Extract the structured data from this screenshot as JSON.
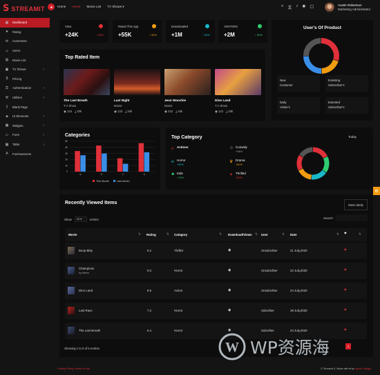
{
  "brand": {
    "name": "STREAMIT"
  },
  "topnav": {
    "home": "Home",
    "items": [
      "Home",
      "Movie List",
      "TV Shows"
    ],
    "active": 1
  },
  "user": {
    "name": "Austin Robertson",
    "role": "Marketing Administrator"
  },
  "sidebar": {
    "items": [
      {
        "label": "Dashboard",
        "icon": "dashboard-icon",
        "active": true,
        "chev": false
      },
      {
        "label": "Rating",
        "icon": "star-icon",
        "chev": false
      },
      {
        "label": "Comments",
        "icon": "comment-icon",
        "chev": false
      },
      {
        "label": "Users",
        "icon": "user-icon",
        "chev": false
      },
      {
        "label": "Movie List",
        "icon": "film-icon",
        "chev": false
      },
      {
        "label": "TV Shows",
        "icon": "tv-icon",
        "chev": true
      },
      {
        "label": "Pricing",
        "icon": "price-icon",
        "chev": false
      },
      {
        "label": "Authentication",
        "icon": "lock-icon",
        "chev": true
      },
      {
        "label": "Utilities",
        "icon": "tool-icon",
        "chev": true
      },
      {
        "label": "Blank Page",
        "icon": "page-icon",
        "chev": false
      },
      {
        "label": "UI Elements",
        "icon": "layers-icon",
        "chev": true
      },
      {
        "label": "Widgets",
        "icon": "widget-icon",
        "chev": true
      },
      {
        "label": "Form",
        "icon": "form-icon",
        "chev": true
      },
      {
        "label": "Table",
        "icon": "table-icon",
        "chev": true
      },
      {
        "label": "FontAwesome",
        "icon": "font-icon",
        "chev": false
      }
    ]
  },
  "stats": [
    {
      "label": "View",
      "value": "+24K",
      "change": "↓ 35%",
      "color": "#e0303a",
      "changeColor": "#e0303a"
    },
    {
      "label": "Rated This App",
      "value": "+55K",
      "change": "↑ 50%",
      "color": "#f39c12",
      "changeColor": "#f39c12"
    },
    {
      "label": "Downloaded",
      "value": "+1M",
      "change": "↑ 80%",
      "color": "#1ab8c9",
      "changeColor": "#1ab8c9"
    },
    {
      "label": "VISITORS",
      "value": "+2M",
      "change": "↑ 80%",
      "color": "#2ecc71",
      "changeColor": "#2ecc71"
    }
  ],
  "user_of_product": {
    "title": "User's Of Product",
    "cells": [
      {
        "label": "New",
        "sub": "Customer"
      },
      {
        "label": "Exsisting",
        "sub": "Subscriber's"
      },
      {
        "label": "Daily",
        "sub": "Visitor's"
      },
      {
        "label": "Extented",
        "sub": "Subscriber's"
      }
    ],
    "donut": [
      {
        "value": 30,
        "color": "#e0303a"
      },
      {
        "value": 20,
        "color": "#f39c12"
      },
      {
        "value": 25,
        "color": "#3a8ee6"
      },
      {
        "value": 25,
        "color": "#555"
      }
    ]
  },
  "top_rated": {
    "title": "Top Rated Item",
    "movies": [
      {
        "title": "The Last Breath",
        "genre": "T.V Show",
        "views": "134",
        "downloads": "30k"
      },
      {
        "title": "Last Night",
        "genre": "Movie",
        "views": "133",
        "downloads": "20k"
      },
      {
        "title": "Jeon Woochie",
        "genre": "Movie",
        "views": "222",
        "downloads": "40k"
      },
      {
        "title": "Dino Land",
        "genre": "T.V Show",
        "views": "122",
        "downloads": "25k"
      }
    ]
  },
  "categories": {
    "title": "Categories",
    "legend": [
      "This Month",
      "Last Month"
    ]
  },
  "chart_data": {
    "type": "bar",
    "title": "Categories",
    "ylim": [
      0,
      50
    ],
    "ticks": [
      "50",
      "40",
      "30",
      "20",
      "10",
      "0"
    ],
    "categories": [
      "a",
      "b",
      "c",
      "d"
    ],
    "series": [
      {
        "name": "This Month",
        "color": "#e0303a",
        "values": [
          34,
          43,
          22,
          47
        ]
      },
      {
        "name": "Last Month",
        "color": "#3a8ee6",
        "values": [
          27,
          30,
          13,
          32
        ]
      }
    ]
  },
  "top_category": {
    "title": "Top Category",
    "filter": "Today",
    "items": [
      {
        "label": "Actions",
        "sub": "",
        "color": "#e0303a",
        "icon": "action-icon"
      },
      {
        "label": "Comedy",
        "sub": "+44%",
        "color": "#aaa",
        "icon": "comedy-icon"
      },
      {
        "label": "Horror",
        "sub": "+80%",
        "color": "#1ab8c9",
        "icon": "horror-icon"
      },
      {
        "label": "Drama",
        "sub": "+80%",
        "color": "#f39c12",
        "icon": "drama-icon"
      },
      {
        "label": "Kids",
        "sub": "+74%",
        "color": "#2ecc71",
        "icon": "kids-icon"
      },
      {
        "label": "Thrilled",
        "sub": "+80%",
        "color": "#e0303a",
        "icon": "thriller-icon"
      }
    ],
    "donut": [
      {
        "value": 18,
        "color": "#e0303a"
      },
      {
        "value": 17,
        "color": "#2ecc71"
      },
      {
        "value": 17,
        "color": "#1ab8c9"
      },
      {
        "value": 16,
        "color": "#f39c12"
      },
      {
        "value": 16,
        "color": "#e0303a"
      },
      {
        "value": 16,
        "color": "#555"
      }
    ]
  },
  "recent": {
    "title": "Recently Viewed Items",
    "filter": "Most Likely",
    "show": "Show",
    "count": "10",
    "entries": "entries",
    "search": "Search:",
    "columns": [
      "Movie",
      "Rating",
      "Category",
      "Download/Views",
      "User",
      "Date"
    ],
    "rows": [
      {
        "movie": "Boop Bitty",
        "sub": "",
        "rating": "6.2",
        "category": "Thriller",
        "user": "Unsubcriber",
        "date": "21 July,2020"
      },
      {
        "movie": "Champions",
        "sub": "by Admin",
        "rating": "9.3",
        "category": "Horror",
        "user": "Unsubcriber",
        "date": "22 July,2020"
      },
      {
        "movie": "Dino Land",
        "sub": "",
        "rating": "8.5",
        "category": "Action",
        "user": "Unsubcriber",
        "date": "24 July,2020"
      },
      {
        "movie": "Last Race",
        "sub": "",
        "rating": "7.2",
        "category": "Horror",
        "user": "Subcriber",
        "date": "28 July,2020"
      },
      {
        "movie": "The Last Breath",
        "sub": "",
        "rating": "6.4",
        "category": "Horror",
        "user": "Subcriber",
        "date": "24 July,2020"
      }
    ],
    "footer": "Showing 1 to 5 of 5 entries"
  },
  "footer": {
    "links": "Privacy Policy   Terms of Use",
    "copy": "© Streamit 6, Made with ♥ by",
    "brand": "Iqonic Design"
  },
  "watermark": "WP资源海"
}
